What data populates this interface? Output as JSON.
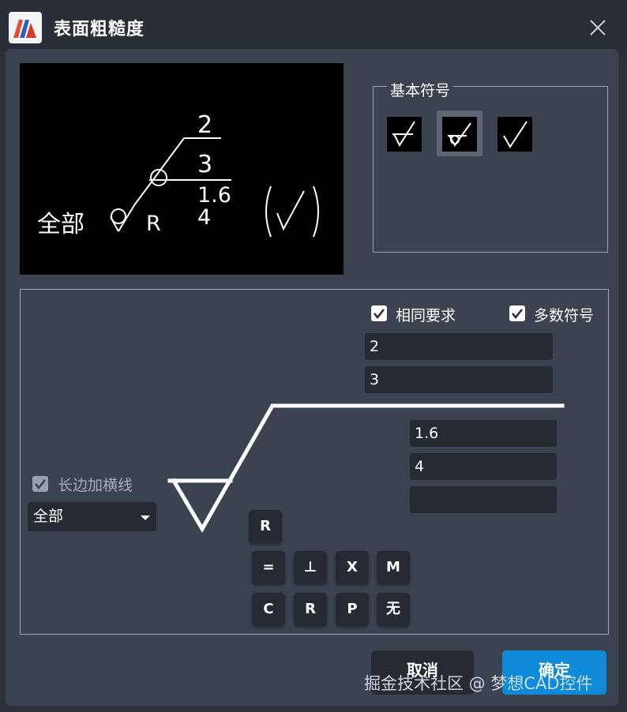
{
  "window": {
    "title": "表面粗糙度"
  },
  "preview": {
    "all_label": "全部",
    "r_label": "R",
    "top_value": "2",
    "second_value": "3",
    "third_value": "1.6",
    "fourth_value": "4"
  },
  "basic_symbols": {
    "legend": "基本符号",
    "symbols": [
      "basic-symbol-open-triangle",
      "basic-symbol-circle-triangle",
      "basic-symbol-plain-check"
    ],
    "selected_index": 1
  },
  "params": {
    "same_requirement": {
      "label": "相同要求",
      "checked": true
    },
    "majority_symbol": {
      "label": "多数符号",
      "checked": true
    },
    "long_edge_line": {
      "label": "长边加横线",
      "checked": true,
      "disabled": true
    },
    "field_a": "2",
    "field_b": "3",
    "field_c": "1.6",
    "field_d": "4",
    "field_e": "",
    "range_dropdown": "全部"
  },
  "keys": {
    "r": "R",
    "row1": [
      "=",
      "⊥",
      "X",
      "M"
    ],
    "row2": [
      "C",
      "R",
      "P",
      "无"
    ]
  },
  "buttons": {
    "cancel": "取消",
    "ok": "确定"
  },
  "watermark": "掘金技术社区 @ 梦想CAD控件",
  "colors": {
    "accent": "#0f8ad8",
    "panel": "#3b4250",
    "field": "#262b33"
  }
}
